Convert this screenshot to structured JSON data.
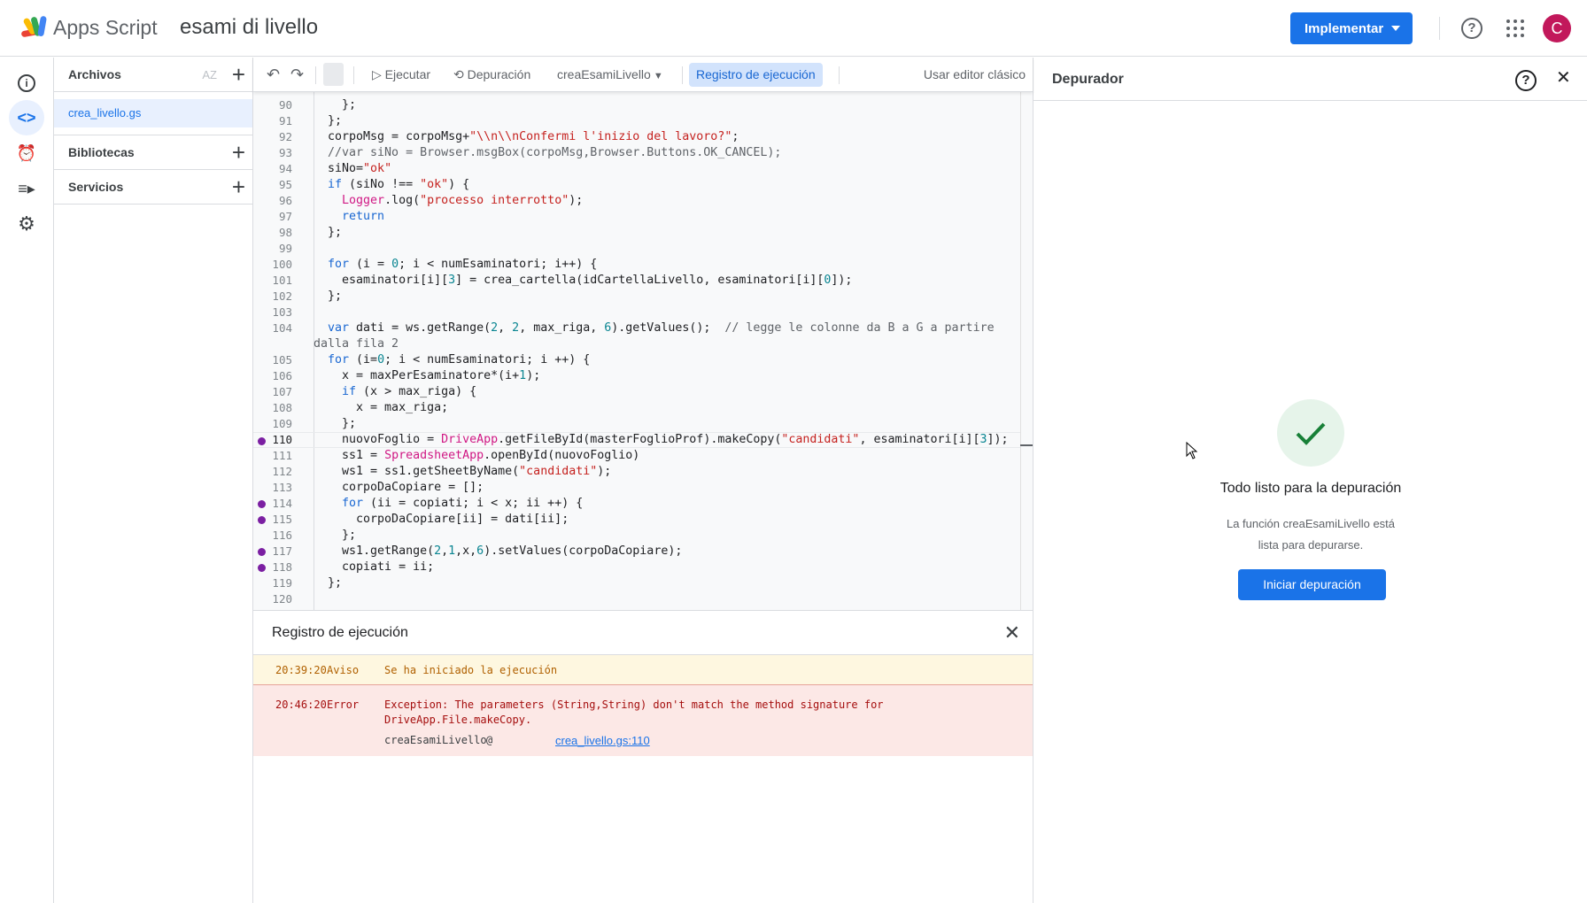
{
  "header": {
    "app_name": "Apps Script",
    "project_title": "esami di livello",
    "deploy_label": "Implementar",
    "avatar_letter": "C",
    "icons": [
      "help-icon",
      "apps-grid-icon"
    ]
  },
  "colors": {
    "accent": "#1a73e8",
    "breakpoint": "#7b1fa2",
    "warn_bg": "#fef7e0",
    "error_bg": "#fce8e6",
    "avatar": "#c2185b"
  },
  "files_panel": {
    "files_title": "Archivos",
    "sort_label": "AZ",
    "files": [
      {
        "name": "crea_livello.gs",
        "selected": true
      }
    ],
    "libraries_title": "Bibliotecas",
    "services_title": "Servicios"
  },
  "toolbar": {
    "run_label": "Ejecutar",
    "debug_label": "Depuración",
    "function_name": "creaEsamiLivello",
    "execution_log_label": "Registro de ejecución",
    "classic_editor_label": "Usar editor clásico"
  },
  "editor": {
    "current_line": 110,
    "breakpoints": [
      110,
      114,
      115,
      117,
      118
    ],
    "lines": [
      {
        "n": "90",
        "t": [
          [
            "pl",
            "    };"
          ]
        ]
      },
      {
        "n": "91",
        "t": [
          [
            "pl",
            "  };"
          ]
        ]
      },
      {
        "n": "92",
        "t": [
          [
            "pl",
            "  corpoMsg = corpoMsg+"
          ],
          [
            "str",
            "\"\\\\n\\\\nConfermi l'inizio del lavoro?\""
          ],
          [
            "pl",
            ";"
          ]
        ]
      },
      {
        "n": "93",
        "t": [
          [
            "cm",
            "  //var siNo = Browser.msgBox(corpoMsg,Browser.Buttons.OK_CANCEL);"
          ]
        ]
      },
      {
        "n": "94",
        "t": [
          [
            "pl",
            "  siNo="
          ],
          [
            "str",
            "\"ok\""
          ]
        ]
      },
      {
        "n": "95",
        "t": [
          [
            "kw",
            "  if"
          ],
          [
            "pl",
            " (siNo !== "
          ],
          [
            "str",
            "\"ok\""
          ],
          [
            "pl",
            ") {"
          ]
        ]
      },
      {
        "n": "96",
        "t": [
          [
            "cls",
            "    Logger"
          ],
          [
            "pl",
            ".log("
          ],
          [
            "str",
            "\"processo interrotto\""
          ],
          [
            "pl",
            ");"
          ]
        ]
      },
      {
        "n": "97",
        "t": [
          [
            "kw",
            "    return"
          ]
        ]
      },
      {
        "n": "98",
        "t": [
          [
            "pl",
            "  };"
          ]
        ]
      },
      {
        "n": "99",
        "t": [
          [
            "pl",
            ""
          ]
        ]
      },
      {
        "n": "100",
        "t": [
          [
            "kw",
            "  for"
          ],
          [
            "pl",
            " (i = "
          ],
          [
            "num",
            "0"
          ],
          [
            "pl",
            "; i < numEsaminatori; i++) {"
          ]
        ]
      },
      {
        "n": "101",
        "t": [
          [
            "pl",
            "    esaminatori[i]["
          ],
          [
            "num",
            "3"
          ],
          [
            "pl",
            "] = crea_cartella(idCartellaLivello, esaminatori[i]["
          ],
          [
            "num",
            "0"
          ],
          [
            "pl",
            "]);"
          ]
        ]
      },
      {
        "n": "102",
        "t": [
          [
            "pl",
            "  };"
          ]
        ]
      },
      {
        "n": "103",
        "t": [
          [
            "pl",
            ""
          ]
        ]
      },
      {
        "n": "104",
        "t": [
          [
            "kw",
            "  var"
          ],
          [
            "pl",
            " dati = ws.getRange("
          ],
          [
            "num",
            "2"
          ],
          [
            "pl",
            ", "
          ],
          [
            "num",
            "2"
          ],
          [
            "pl",
            ", max_riga, "
          ],
          [
            "num",
            "6"
          ],
          [
            "pl",
            ").getValues();  "
          ],
          [
            "cm",
            "// legge le colonne da B a G a partire"
          ]
        ]
      },
      {
        "n": "",
        "t": [
          [
            "cm",
            "dalla fila 2"
          ]
        ]
      },
      {
        "n": "105",
        "t": [
          [
            "kw",
            "  for"
          ],
          [
            "pl",
            " (i="
          ],
          [
            "num",
            "0"
          ],
          [
            "pl",
            "; i < numEsaminatori; i ++) {"
          ]
        ]
      },
      {
        "n": "106",
        "t": [
          [
            "pl",
            "    x = maxPerEsaminatore*(i+"
          ],
          [
            "num",
            "1"
          ],
          [
            "pl",
            ");"
          ]
        ]
      },
      {
        "n": "107",
        "t": [
          [
            "kw",
            "    if"
          ],
          [
            "pl",
            " (x > max_riga) {"
          ]
        ]
      },
      {
        "n": "108",
        "t": [
          [
            "pl",
            "      x = max_riga;"
          ]
        ]
      },
      {
        "n": "109",
        "t": [
          [
            "pl",
            "    };"
          ]
        ]
      },
      {
        "n": "110",
        "t": [
          [
            "pl",
            "    nuovoFoglio = "
          ],
          [
            "cls",
            "DriveApp"
          ],
          [
            "pl",
            ".getFileById(masterFoglioProf).makeCopy("
          ],
          [
            "str",
            "\"candidati\""
          ],
          [
            "pl",
            ", esaminatori[i]["
          ],
          [
            "num",
            "3"
          ],
          [
            "pl",
            "]);"
          ]
        ]
      },
      {
        "n": "111",
        "t": [
          [
            "pl",
            "    ss1 = "
          ],
          [
            "cls",
            "SpreadsheetApp"
          ],
          [
            "pl",
            ".openById(nuovoFoglio)"
          ]
        ]
      },
      {
        "n": "112",
        "t": [
          [
            "pl",
            "    ws1 = ss1.getSheetByName("
          ],
          [
            "str",
            "\"candidati\""
          ],
          [
            "pl",
            ");"
          ]
        ]
      },
      {
        "n": "113",
        "t": [
          [
            "pl",
            "    corpoDaCopiare = [];"
          ]
        ]
      },
      {
        "n": "114",
        "t": [
          [
            "kw",
            "    for"
          ],
          [
            "pl",
            " (ii = copiati; i < x; ii ++) {"
          ]
        ]
      },
      {
        "n": "115",
        "t": [
          [
            "pl",
            "      corpoDaCopiare[ii] = dati[ii];"
          ]
        ]
      },
      {
        "n": "116",
        "t": [
          [
            "pl",
            "    };"
          ]
        ]
      },
      {
        "n": "117",
        "t": [
          [
            "pl",
            "    ws1.getRange("
          ],
          [
            "num",
            "2"
          ],
          [
            "pl",
            ","
          ],
          [
            "num",
            "1"
          ],
          [
            "pl",
            ",x,"
          ],
          [
            "num",
            "6"
          ],
          [
            "pl",
            ").setValues(corpoDaCopiare);"
          ]
        ]
      },
      {
        "n": "118",
        "t": [
          [
            "pl",
            "    copiati = ii;"
          ]
        ]
      },
      {
        "n": "119",
        "t": [
          [
            "pl",
            "  };"
          ]
        ]
      },
      {
        "n": "120",
        "t": [
          [
            "pl",
            ""
          ]
        ]
      }
    ]
  },
  "execution_log": {
    "title": "Registro de ejecución",
    "entries": [
      {
        "time": "20:39:20",
        "level": "Aviso",
        "message": "Se ha iniciado la ejecución"
      },
      {
        "time": "20:46:20",
        "level": "Error",
        "message_line1": "Exception: The parameters (String,String) don't match the method signature for",
        "message_line2": "DriveApp.File.makeCopy.",
        "stack_function": "creaEsamiLivello",
        "stack_at": "@",
        "stack_link": "crea_livello.gs:110"
      }
    ]
  },
  "debugger": {
    "title": "Depurador",
    "ready_title": "Todo listo para la depuración",
    "ready_description": "La función creaEsamiLivello está lista para depurarse.",
    "start_label": "Iniciar depuración"
  }
}
